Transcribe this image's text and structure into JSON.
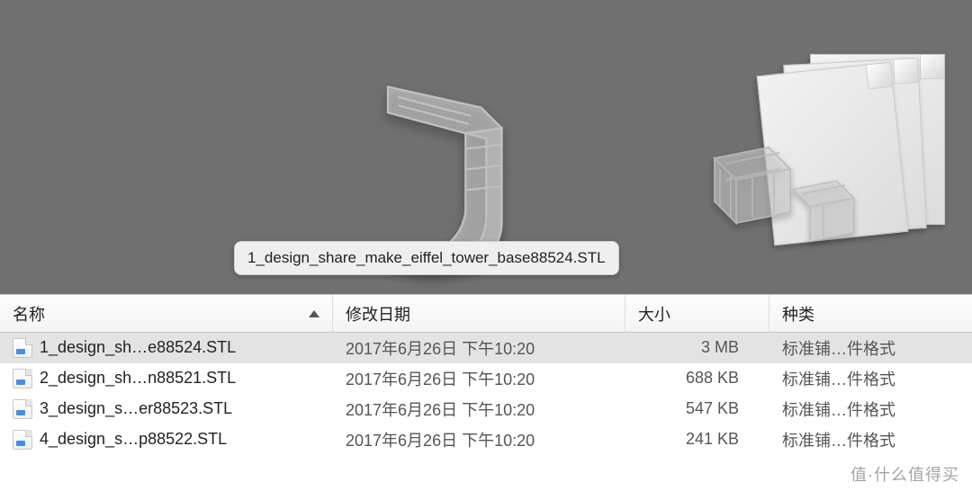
{
  "preview": {
    "tooltip": "1_design_share_make_eiffel_tower_base88524.STL"
  },
  "columns": {
    "name": "名称",
    "date": "修改日期",
    "size": "大小",
    "kind": "种类"
  },
  "rows": [
    {
      "name": "1_design_sh…e88524.STL",
      "date": "2017年6月26日 下午10:20",
      "size": "3 MB",
      "kind": "标准铺…件格式",
      "selected": true
    },
    {
      "name": "2_design_sh…n88521.STL",
      "date": "2017年6月26日 下午10:20",
      "size": "688 KB",
      "kind": "标准铺…件格式",
      "selected": false
    },
    {
      "name": "3_design_s…er88523.STL",
      "date": "2017年6月26日 下午10:20",
      "size": "547 KB",
      "kind": "标准铺…件格式",
      "selected": false
    },
    {
      "name": "4_design_s…p88522.STL",
      "date": "2017年6月26日 下午10:20",
      "size": "241 KB",
      "kind": "标准铺…件格式",
      "selected": false
    }
  ],
  "watermark": "值·什么值得买"
}
